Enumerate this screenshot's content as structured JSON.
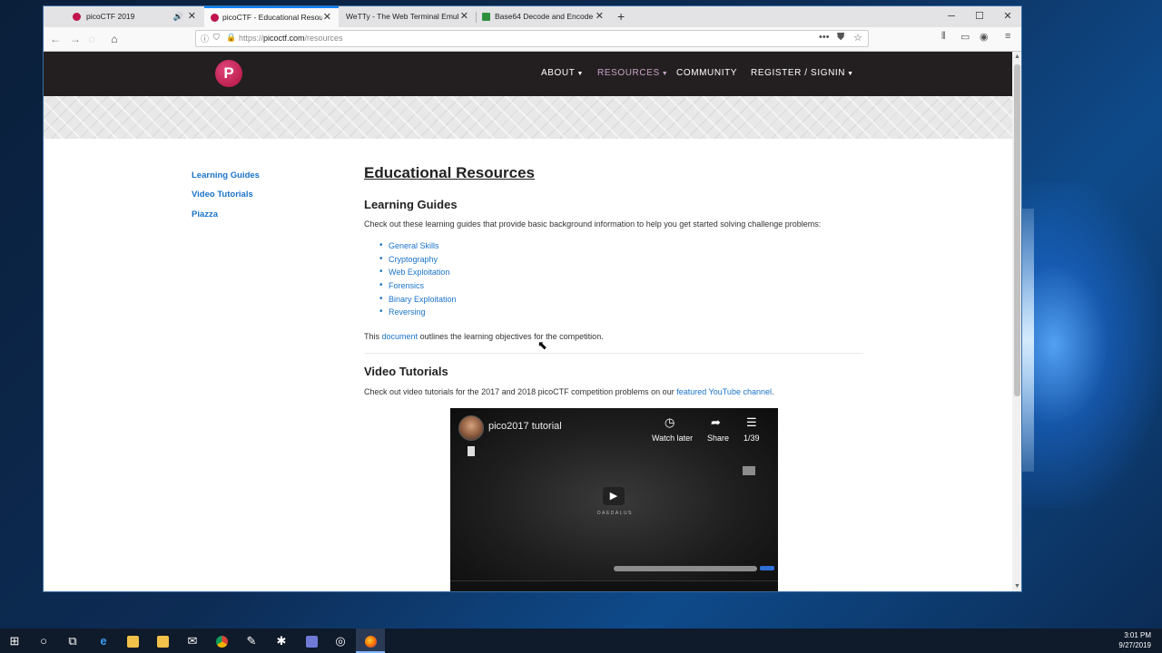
{
  "browser": {
    "tabs": [
      {
        "label": "picoCTF 2019",
        "active": false,
        "sound": true,
        "favicon_color": "#c0154c"
      },
      {
        "label": "picoCTF - Educational Resources",
        "active": true,
        "favicon_color": "#c0154c"
      },
      {
        "label": "WeTTy - The Web Terminal Emulator",
        "active": false,
        "favicon_color": "#2b2b2b"
      },
      {
        "label": "Base64 Decode and Encode - Online",
        "active": false,
        "favicon_color": "#2f8f3e"
      }
    ],
    "url_scheme": "https://",
    "url_host": "picoctf.com",
    "url_path": "/resources"
  },
  "site": {
    "logo_letter": "P",
    "menu": [
      {
        "label": "ABOUT",
        "caret": true,
        "active": false
      },
      {
        "label": "RESOURCES",
        "caret": true,
        "active": true
      },
      {
        "label": "COMMUNITY",
        "caret": false,
        "active": false
      },
      {
        "label": "REGISTER / SIGNIN",
        "caret": true,
        "active": false
      }
    ]
  },
  "sidebar": {
    "items": [
      {
        "label": "Learning Guides"
      },
      {
        "label": "Video Tutorials"
      },
      {
        "label": "Piazza"
      }
    ]
  },
  "content": {
    "title": "Educational Resources",
    "learning": {
      "heading": "Learning Guides",
      "intro": "Check out these learning guides that provide basic background information to help you get started solving challenge problems:",
      "guides": [
        "General Skills",
        "Cryptography",
        "Web Exploitation",
        "Forensics",
        "Binary Exploitation",
        "Reversing"
      ],
      "doc_prefix": "This",
      "doc_link": "document",
      "doc_suffix": "outlines the learning objectives for the competition."
    },
    "videos": {
      "heading": "Video Tutorials",
      "intro_prefix": "Check out video tutorials for the 2017 and 2018 picoCTF competition problems on our",
      "intro_link": "featured YouTube channel",
      "intro_suffix": ".",
      "embed": {
        "title": "pico2017 tutorial",
        "watch_later": "Watch later",
        "share": "Share",
        "playlist_count": "1/39",
        "wordmark": "DAEDALUS"
      }
    }
  },
  "os": {
    "time": "3:01 PM",
    "date": "9/27/2019"
  },
  "colors": {
    "link": "#1a73c9",
    "header_bg": "#231f20",
    "brand": "#c0154c"
  }
}
